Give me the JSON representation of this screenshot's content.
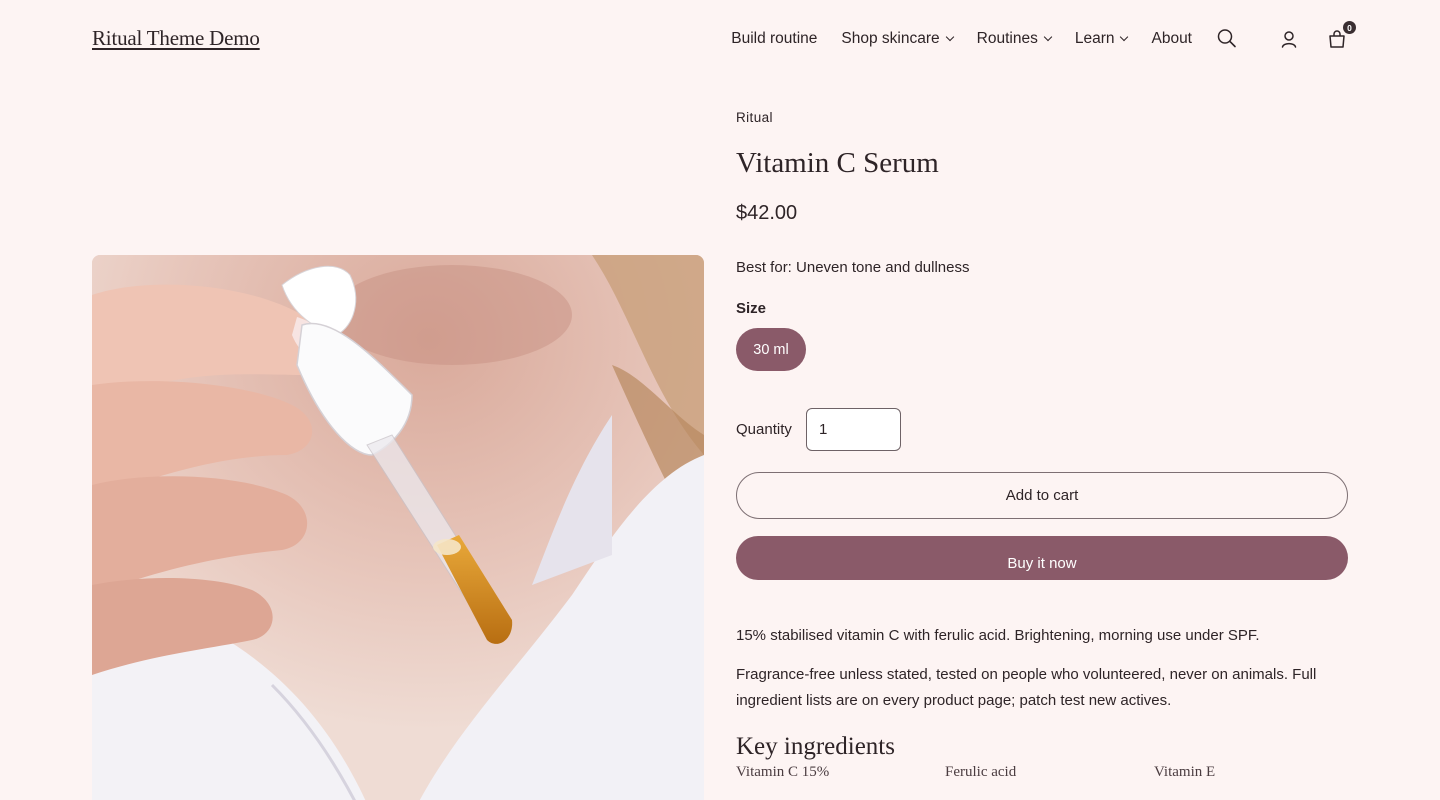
{
  "header": {
    "logo": "Ritual Theme Demo",
    "nav": [
      {
        "label": "Build routine",
        "dropdown": false
      },
      {
        "label": "Shop skincare",
        "dropdown": true
      },
      {
        "label": "Routines",
        "dropdown": true
      },
      {
        "label": "Learn",
        "dropdown": true
      },
      {
        "label": "About",
        "dropdown": false
      }
    ],
    "icons": [
      "search-icon",
      "account-icon",
      "cart-icon"
    ],
    "cart_count": "0"
  },
  "product": {
    "vendor": "Ritual",
    "title": "Vitamin C Serum",
    "price": "$42.00",
    "best_for": "Best for: Uneven tone and dullness",
    "size_label": "Size",
    "size_option": "30 ml",
    "quantity_label": "Quantity",
    "quantity_value": "1",
    "add_to_cart": "Add to cart",
    "buy_now": "Buy it now",
    "description_1": "15% stabilised vitamin C with ferulic acid. Brightening, morning use under SPF.",
    "description_2": "Fragrance-free unless stated, tested on people who volunteered, never on animals. Full ingredient lists are on every product page; patch test new actives.",
    "ingredients_title": "Key ingredients",
    "ingredients": [
      "Vitamin C 15%",
      "Ferulic acid",
      "Vitamin E"
    ]
  },
  "colors": {
    "background": "#fdf4f3",
    "accent": "#8a5a69",
    "text": "#2e2427"
  }
}
